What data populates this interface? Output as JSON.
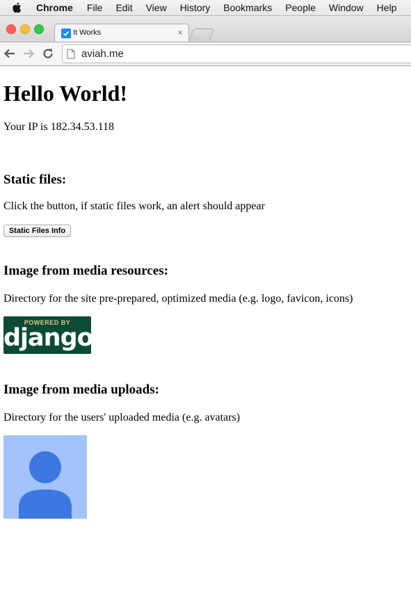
{
  "menubar": {
    "app_name": "Chrome",
    "items": [
      "File",
      "Edit",
      "View",
      "History",
      "Bookmarks",
      "People",
      "Window",
      "Help"
    ]
  },
  "tab": {
    "title": "It Works",
    "close_glyph": "×"
  },
  "toolbar": {
    "url": "aviah.me"
  },
  "page": {
    "title": "Hello World!",
    "ip_text": "Your IP is 182.34.53.118",
    "static_heading": "Static files:",
    "static_text": "Click the button, if static files work, an alert should appear",
    "static_button": "Static Files Info",
    "media_heading": "Image from media resources:",
    "media_text": "Directory for the site pre-prepared, optimized media (e.g. logo, favicon, icons)",
    "django_badge_top": "POWERED BY",
    "django_badge_word": "django",
    "uploads_heading": "Image from media uploads:",
    "uploads_text": "Directory for the users' uploaded media (e.g. avatars)"
  },
  "colors": {
    "django_green": "#0c4b33",
    "avatar_bg": "#a2c3fc",
    "avatar_fg": "#3d78e0",
    "favicon_blue": "#1a8cf0"
  }
}
